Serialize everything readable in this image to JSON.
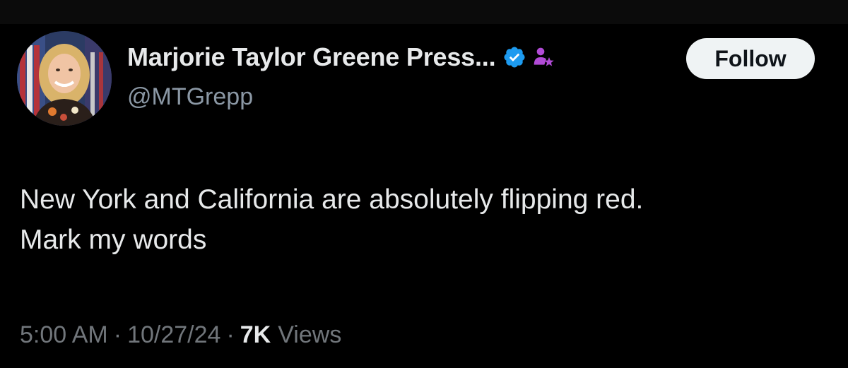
{
  "post": {
    "author": {
      "display_name": "Marjorie Taylor Greene Press...",
      "handle": "@MTGrepp",
      "avatar_icon": "profile-photo",
      "verified_icon": "verified-badge-icon",
      "affiliate_icon": "affiliate-badge-icon"
    },
    "follow_label": "Follow",
    "text": "New York and California are absolutely flipping red.\nMark my words",
    "meta": {
      "time": "5:00 AM",
      "separator": "·",
      "date": "10/27/24",
      "views_count": "7K",
      "views_label": "Views"
    }
  },
  "colors": {
    "background": "#000000",
    "primary_text": "#e7e9ea",
    "secondary_text": "#8b98a5",
    "verified_blue": "#1d9bf0",
    "affiliate_purple": "#b14bd6",
    "follow_bg": "#eff3f4"
  }
}
